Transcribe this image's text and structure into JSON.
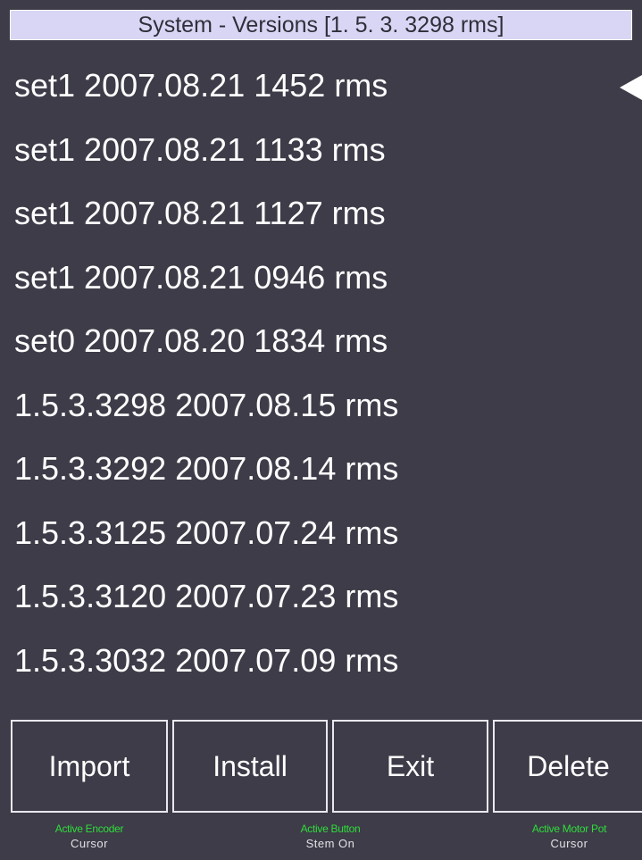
{
  "window": {
    "title": "System - Versions [1. 5. 3. 3298 rms]"
  },
  "versions": [
    {
      "label": "set1 2007.08.21 1452 rms",
      "selected": true
    },
    {
      "label": "set1 2007.08.21 1133 rms"
    },
    {
      "label": "set1 2007.08.21 1127 rms"
    },
    {
      "label": "set1 2007.08.21 0946 rms"
    },
    {
      "label": "set0 2007.08.20 1834 rms"
    },
    {
      "label": "1.5.3.3298 2007.08.15 rms"
    },
    {
      "label": "1.5.3.3292 2007.08.14 rms"
    },
    {
      "label": "1.5.3.3125 2007.07.24 rms"
    },
    {
      "label": "1.5.3.3120 2007.07.23 rms"
    },
    {
      "label": "1.5.3.3032 2007.07.09 rms"
    }
  ],
  "buttons": {
    "import": "Import",
    "install": "Install",
    "exit": "Exit",
    "delete": "Delete"
  },
  "status": {
    "encoder_label": "Active Encoder",
    "encoder_value": "Cursor",
    "button_label": "Active Button",
    "button_value": "Stem On",
    "motor_pot_label": "Active Motor Pot",
    "motor_pot_value": "Cursor"
  },
  "icons": {
    "selection_cursor": "left-pointing-triangle"
  },
  "colors": {
    "background": "#3d3c48",
    "title_bar": "#d8d6f4",
    "text": "#ffffff",
    "status_label": "#2fdc3a"
  }
}
